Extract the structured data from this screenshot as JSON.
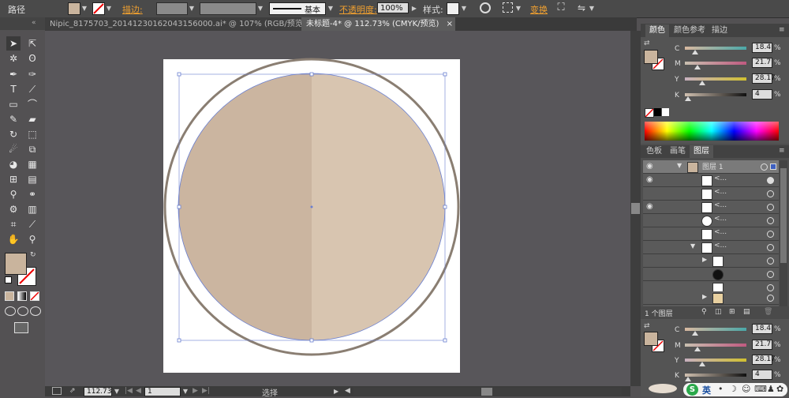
{
  "control_bar": {
    "object_type": "路径",
    "stroke_label": "描边:",
    "stroke_profile": "基本",
    "opacity_label": "不透明度:",
    "opacity_value": "100%",
    "style_label": "样式:",
    "transform_link": "变换",
    "fill_color": "#c9b49d"
  },
  "tabs": [
    {
      "label": "Nipic_8175703_20141230162043156000.ai* @ 107% (RGB/预览)",
      "active": false
    },
    {
      "label": "未标题-4* @ 112.73% (CMYK/预览)",
      "active": true
    }
  ],
  "canvas": {
    "left_half_color": "#cbb5a0",
    "right_half_color": "#d8c5b0",
    "ring_color": "#8a7e72"
  },
  "color_panel": {
    "tabs": [
      "颜色",
      "颜色参考",
      "描边"
    ],
    "channels": [
      {
        "name": "C",
        "value": "18.4",
        "unit": "%"
      },
      {
        "name": "M",
        "value": "21.7",
        "unit": "%"
      },
      {
        "name": "Y",
        "value": "28.17",
        "unit": "%"
      },
      {
        "name": "K",
        "value": "4",
        "unit": "%"
      }
    ]
  },
  "layers_panel": {
    "tabs": [
      "色板",
      "画笔",
      "图层"
    ],
    "top_layer_name": "图层 1",
    "sublayer_label": "<...",
    "footer_text": "1 个图层"
  },
  "status_bar": {
    "zoom": "112.73",
    "page": "1",
    "tool_name": "选择"
  },
  "taskbar": {
    "ime_label": "英"
  }
}
